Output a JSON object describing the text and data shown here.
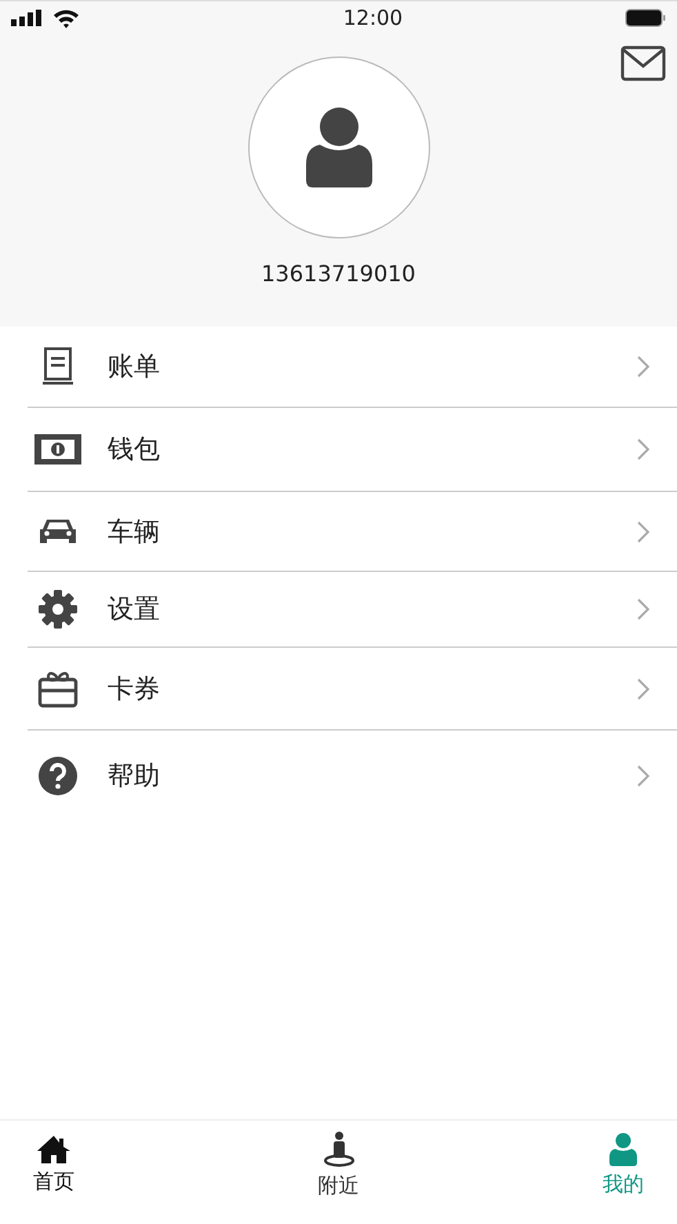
{
  "status_bar": {
    "time": "12:00"
  },
  "profile": {
    "phone": "13613719010"
  },
  "menu": [
    {
      "kind": "bill",
      "label": "账单"
    },
    {
      "kind": "wallet",
      "label": "钱包"
    },
    {
      "kind": "car",
      "label": "车辆"
    },
    {
      "kind": "settings",
      "label": "设置"
    },
    {
      "kind": "coupon",
      "label": "卡券"
    },
    {
      "kind": "help",
      "label": "帮助"
    }
  ],
  "tabs": [
    {
      "kind": "home",
      "label": "首页",
      "selected": false
    },
    {
      "kind": "nearby",
      "label": "附近",
      "selected": false
    },
    {
      "kind": "me",
      "label": "我的",
      "selected": true
    }
  ]
}
